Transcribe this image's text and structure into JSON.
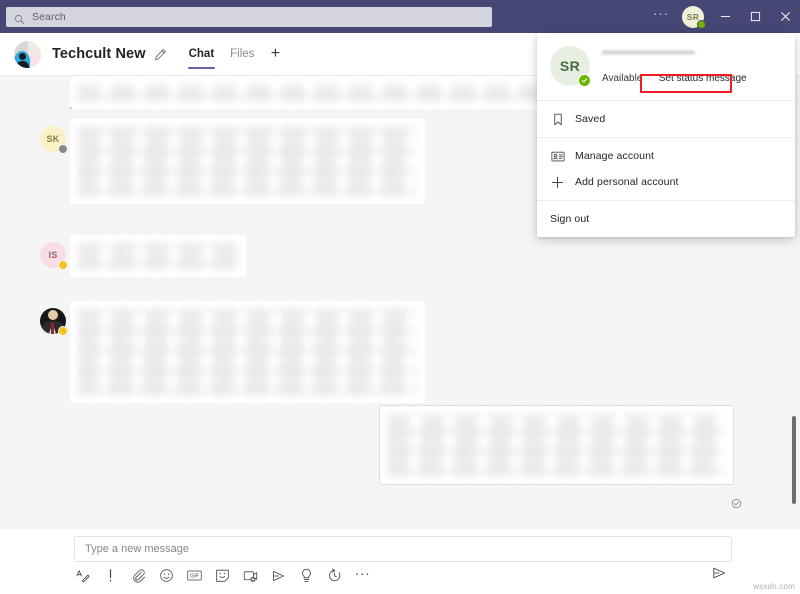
{
  "titlebar": {
    "search": {
      "placeholder": "Search",
      "icon": "search-icon"
    },
    "overflow_label": "···",
    "avatar_initials": "SR",
    "presence_status": "available",
    "minimize_label": "Minimize",
    "maximize_label": "Maximize",
    "close_label": "Close",
    "bar_color": "#464775"
  },
  "chat_header": {
    "title": "Techcult New",
    "edit_icon": "pencil-icon",
    "tabs": [
      {
        "label": "Chat",
        "active": true
      },
      {
        "label": "Files",
        "active": false
      }
    ],
    "add_tab_label": "+",
    "accent_color": "#6264a7"
  },
  "messages": {
    "urgent_accent_color": "#c4693a",
    "rows": [
      {
        "sender_initials": "SK",
        "presence": "offline",
        "content": "(blurred message content)"
      },
      {
        "sender_initials": "IS",
        "presence": "away",
        "content": "(blurred message content)"
      },
      {
        "sender_initials": "",
        "presence": "away",
        "content": "(blurred message content)"
      }
    ],
    "outgoing": {
      "content": "(blurred message content)",
      "status_icon": "seen-check-icon"
    }
  },
  "compose": {
    "placeholder": "Type a new message",
    "value": "",
    "tools": [
      "format-icon",
      "priority-icon",
      "attach-icon",
      "emoji-icon",
      "giphy-icon",
      "sticker-icon",
      "meet-now-icon",
      "stream-icon",
      "praise-icon",
      "schedule-send-icon",
      "more-options-icon"
    ],
    "send_icon": "send-icon"
  },
  "account_menu": {
    "avatar_initials": "SR",
    "email": "••••••••••••••••••••••••••••••••",
    "status": "Available",
    "status_separator": "·",
    "status_message_link": "Set status message",
    "items": [
      {
        "label": "Saved",
        "icon": "bookmark-icon"
      },
      {
        "label": "Manage account",
        "icon": "account-card-icon"
      },
      {
        "label": "Add personal account",
        "icon": "plus-icon"
      },
      {
        "label": "Sign out",
        "icon": ""
      }
    ],
    "highlight_color": "#ee1c24"
  },
  "watermark": {
    "text": "wsxdn.com"
  }
}
